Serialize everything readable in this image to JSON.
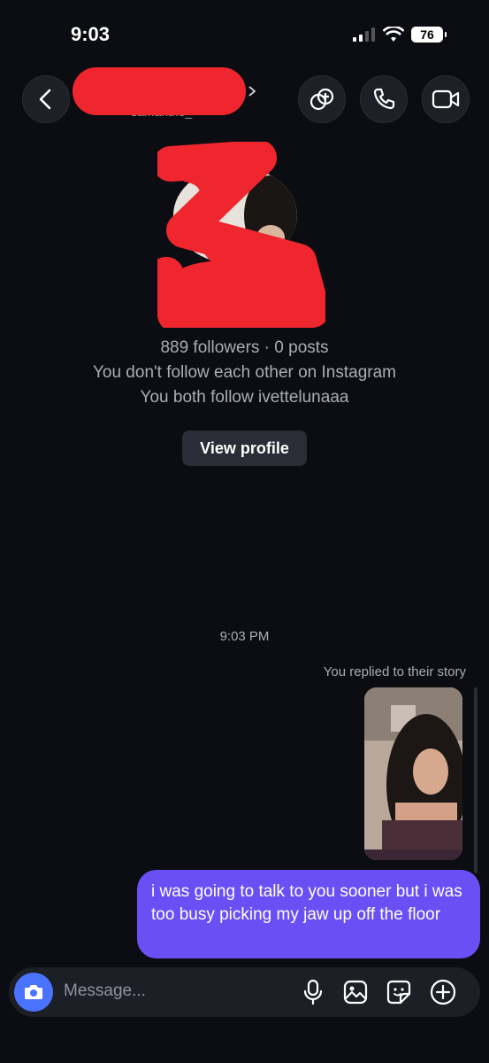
{
  "status_bar": {
    "time": "9:03",
    "battery": "76"
  },
  "header": {
    "username_partial": "samantho_"
  },
  "profile": {
    "stats": "889 followers · 0 posts",
    "follow_status": "You don't follow each other on Instagram",
    "mutual": "You both follow ivettelunaaa",
    "view_profile_label": "View profile"
  },
  "thread": {
    "timestamp": "9:03 PM",
    "story_reply_label": "You replied to their story",
    "message": "i was going to talk to you sooner but i was too busy picking my jaw up off the floor"
  },
  "composer": {
    "placeholder": "Message..."
  },
  "colors": {
    "accent": "#6a4ff5",
    "camera": "#4a73ff",
    "redaction": "#f0262e"
  }
}
